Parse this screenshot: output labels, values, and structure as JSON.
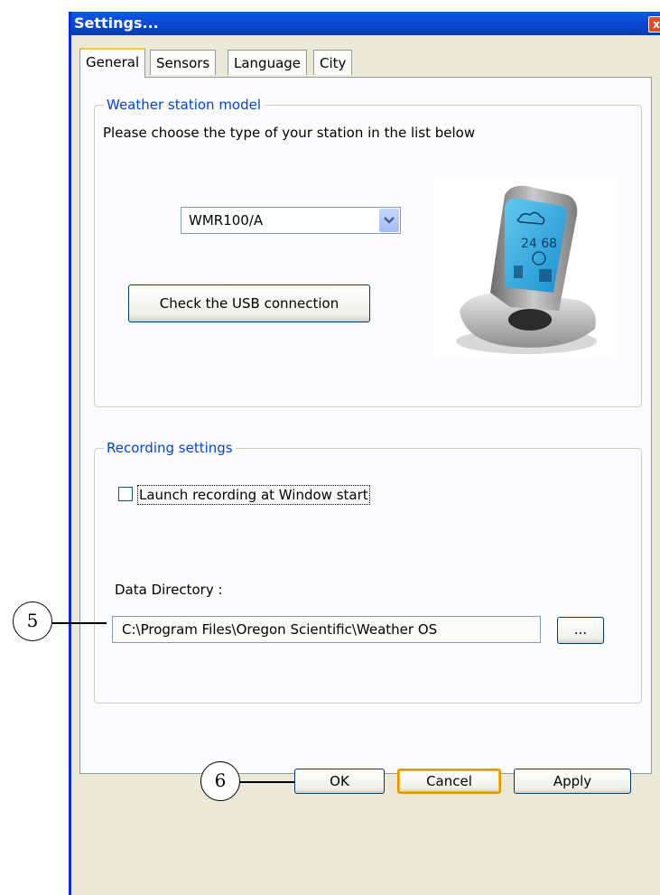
{
  "window": {
    "title": "Settings...",
    "close_glyph": "x"
  },
  "tabs": [
    {
      "label": "General",
      "active": true
    },
    {
      "label": "Sensors",
      "active": false
    },
    {
      "label": "Language",
      "active": false
    },
    {
      "label": "City",
      "active": false
    }
  ],
  "station": {
    "group_title": "Weather station model",
    "instruction": "Please choose the type of your station in the list below",
    "model_selected": "WMR100/A",
    "check_usb_label": "Check the USB connection"
  },
  "recording": {
    "group_title": "Recording settings",
    "launch_at_start_label": "Launch recording at Window start",
    "launch_at_start_checked": false,
    "data_directory_label": "Data Directory :",
    "data_directory_value": "C:\\Program Files\\Oregon Scientific\\Weather OS",
    "browse_label": "..."
  },
  "buttons": {
    "ok": "OK",
    "cancel": "Cancel",
    "apply": "Apply"
  },
  "callouts": {
    "path_field": "5",
    "ok_button": "6"
  },
  "colors": {
    "accent": "#0046d5",
    "title_bar": "#0a5ae8",
    "tab_highlight": "#ffc83c"
  }
}
